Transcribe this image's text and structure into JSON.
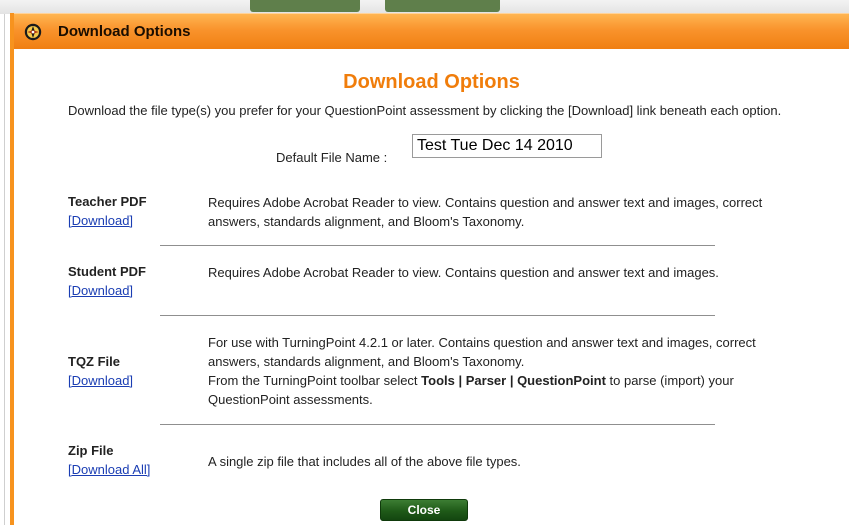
{
  "window": {
    "title": "Download Options"
  },
  "dialog": {
    "heading": "Download Options",
    "intro": "Download the file type(s) you prefer for your QuestionPoint assessment by clicking the [Download] link beneath each option.",
    "filename_label": "Default File Name :",
    "filename_value": "Test Tue Dec 14 2010"
  },
  "options": [
    {
      "name": "Teacher PDF",
      "link": "[Download]",
      "desc": "Requires Adobe Acrobat Reader to view. Contains question and answer text and images, correct answers, standards alignment, and Bloom's Taxonomy."
    },
    {
      "name": "Student PDF",
      "link": "[Download]",
      "desc": "Requires Adobe Acrobat Reader to view. Contains question and answer text and images."
    },
    {
      "name": "TQZ File",
      "link": "[Download]",
      "desc_line1": "For use with TurningPoint 4.2.1 or later. Contains question and answer text and images, correct answers, standards alignment, and Bloom's Taxonomy.",
      "desc_line2_pre": "From the TurningPoint toolbar select ",
      "desc_line2_bold": "Tools | Parser | QuestionPoint",
      "desc_line2_post": " to parse (import) your QuestionPoint assessments."
    },
    {
      "name": "Zip File",
      "link": "[Download All]",
      "desc": "A single zip file that includes all of the above file types."
    }
  ],
  "close_label": "Close",
  "colors": {
    "titlebar": "#f9932c",
    "heading": "#f07d0b",
    "link": "#1a3db3",
    "close_button": "#1f5a18"
  }
}
